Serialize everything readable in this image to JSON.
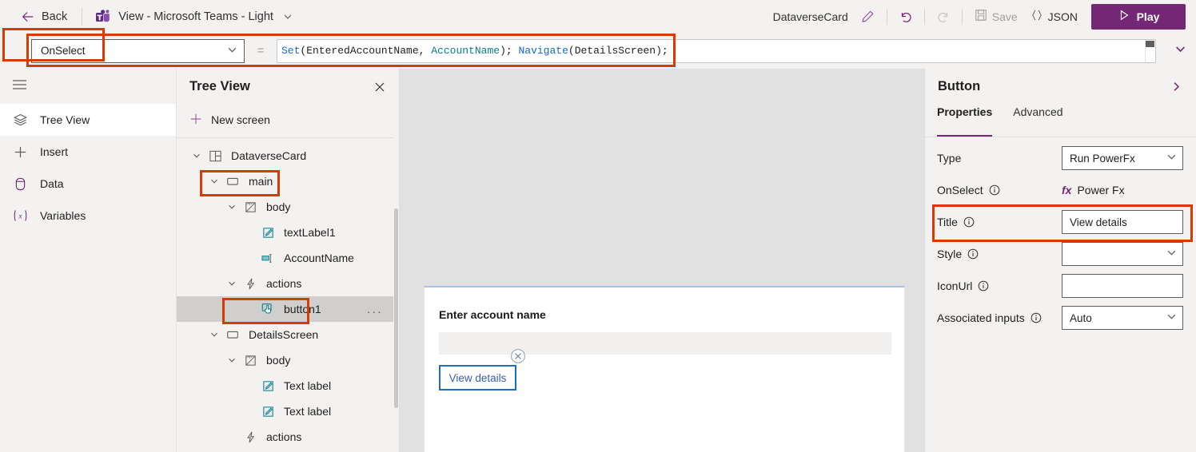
{
  "topbar": {
    "back_label": "Back",
    "back_icon": "arrow-left-icon",
    "app_title": "View - Microsoft Teams - Light",
    "app_icon": "microsoft-teams-icon",
    "title_chevron_icon": "chevron-down-icon",
    "doc_name": "DataverseCard",
    "rename_icon": "pencil-icon",
    "undo_icon": "undo-icon",
    "redo_icon": "redo-icon",
    "save_label": "Save",
    "save_icon": "save-disk-icon",
    "json_label": "JSON",
    "json_icon": "curly-braces-icon",
    "play_label": "Play",
    "play_icon": "play-triangle-icon"
  },
  "formula_bar": {
    "property": "OnSelect",
    "property_chevron_icon": "chevron-down-icon",
    "equals": "=",
    "expand_icon": "chevron-down-icon",
    "tokens": [
      {
        "text": "Set",
        "kind": "fn"
      },
      {
        "text": "(EnteredAccountName, ",
        "kind": "plain"
      },
      {
        "text": "AccountName",
        "kind": "field"
      },
      {
        "text": "); ",
        "kind": "plain"
      },
      {
        "text": "Navigate",
        "kind": "fn"
      },
      {
        "text": "(DetailsScreen);",
        "kind": "plain"
      }
    ],
    "full_formula": "Set(EnteredAccountName, AccountName); Navigate(DetailsScreen);"
  },
  "rail": {
    "menu_icon": "hamburger-icon",
    "items": [
      {
        "label": "Tree View",
        "icon": "layers-icon",
        "active": true
      },
      {
        "label": "Insert",
        "icon": "plus-icon",
        "active": false
      },
      {
        "label": "Data",
        "icon": "database-icon",
        "active": false
      },
      {
        "label": "Variables",
        "icon": "variables-x-icon",
        "active": false
      }
    ]
  },
  "tree": {
    "title": "Tree View",
    "close_icon": "close-icon",
    "new_screen_label": "New screen",
    "new_screen_icon": "plus-icon",
    "nodes": [
      {
        "label": "DataverseCard",
        "icon": "card-grid-icon",
        "indent": 0,
        "twisty": "chevron-down-icon",
        "selected": false,
        "menu": false
      },
      {
        "label": "main",
        "icon": "screen-rect-icon",
        "indent": 1,
        "twisty": "chevron-down-icon",
        "selected": false,
        "menu": false
      },
      {
        "label": "body",
        "icon": "layout-body-icon",
        "indent": 2,
        "twisty": "chevron-down-icon",
        "selected": false,
        "menu": false
      },
      {
        "label": "textLabel1",
        "icon": "text-label-icon",
        "indent": 3,
        "twisty": "",
        "selected": false,
        "menu": false
      },
      {
        "label": "AccountName",
        "icon": "text-input-icon",
        "indent": 3,
        "twisty": "",
        "selected": false,
        "menu": false
      },
      {
        "label": "actions",
        "icon": "lightning-icon",
        "indent": 2,
        "twisty": "chevron-down-icon",
        "selected": false,
        "menu": false
      },
      {
        "label": "button1",
        "icon": "button-pointer-icon",
        "indent": 3,
        "twisty": "",
        "selected": true,
        "menu": true,
        "menu_label": "..."
      },
      {
        "label": "DetailsScreen",
        "icon": "screen-rect-icon",
        "indent": 1,
        "twisty": "chevron-down-icon",
        "selected": false,
        "menu": false
      },
      {
        "label": "body",
        "icon": "layout-body-icon",
        "indent": 2,
        "twisty": "chevron-down-icon",
        "selected": false,
        "menu": false
      },
      {
        "label": "Text label",
        "icon": "text-label-icon",
        "indent": 3,
        "twisty": "",
        "selected": false,
        "menu": false
      },
      {
        "label": "Text label",
        "icon": "text-label-icon",
        "indent": 3,
        "twisty": "",
        "selected": false,
        "menu": false
      },
      {
        "label": "actions",
        "icon": "lightning-icon",
        "indent": 2,
        "twisty": "",
        "selected": false,
        "menu": false
      }
    ]
  },
  "canvas": {
    "card": {
      "field_label": "Enter account name",
      "input_value": "",
      "button_label": "View details",
      "delete_handle_icon": "circle-x-icon"
    }
  },
  "properties_panel": {
    "title": "Button",
    "collapse_icon": "chevron-right-icon",
    "tabs": [
      {
        "label": "Properties",
        "active": true
      },
      {
        "label": "Advanced",
        "active": false
      }
    ],
    "rows": [
      {
        "label": "Type",
        "info": false,
        "control": "select",
        "value": "Run PowerFx",
        "chevron_icon": "chevron-down-icon"
      },
      {
        "label": "OnSelect",
        "info": true,
        "info_icon": "info-icon",
        "control": "powerfx",
        "value": "Power Fx",
        "fx_glyph": "fx"
      },
      {
        "label": "Title",
        "info": true,
        "info_icon": "info-icon",
        "control": "text",
        "value": "View details",
        "highlighted": true
      },
      {
        "label": "Style",
        "info": true,
        "info_icon": "info-icon",
        "control": "select",
        "value": "",
        "chevron_icon": "chevron-down-icon"
      },
      {
        "label": "IconUrl",
        "info": true,
        "info_icon": "info-icon",
        "control": "text",
        "value": ""
      },
      {
        "label": "Associated inputs",
        "info": true,
        "info_icon": "info-icon",
        "control": "select",
        "value": "Auto",
        "chevron_icon": "chevron-down-icon"
      }
    ]
  },
  "colors": {
    "highlight": "#d83b01",
    "brand_purple": "#742774",
    "accent_blue": "#1b6ec2",
    "formula_fn": "#1268d0",
    "formula_field": "#0b7d88",
    "canvas_bg": "#e1e1e1",
    "chrome_bg": "#f3f2f1"
  }
}
